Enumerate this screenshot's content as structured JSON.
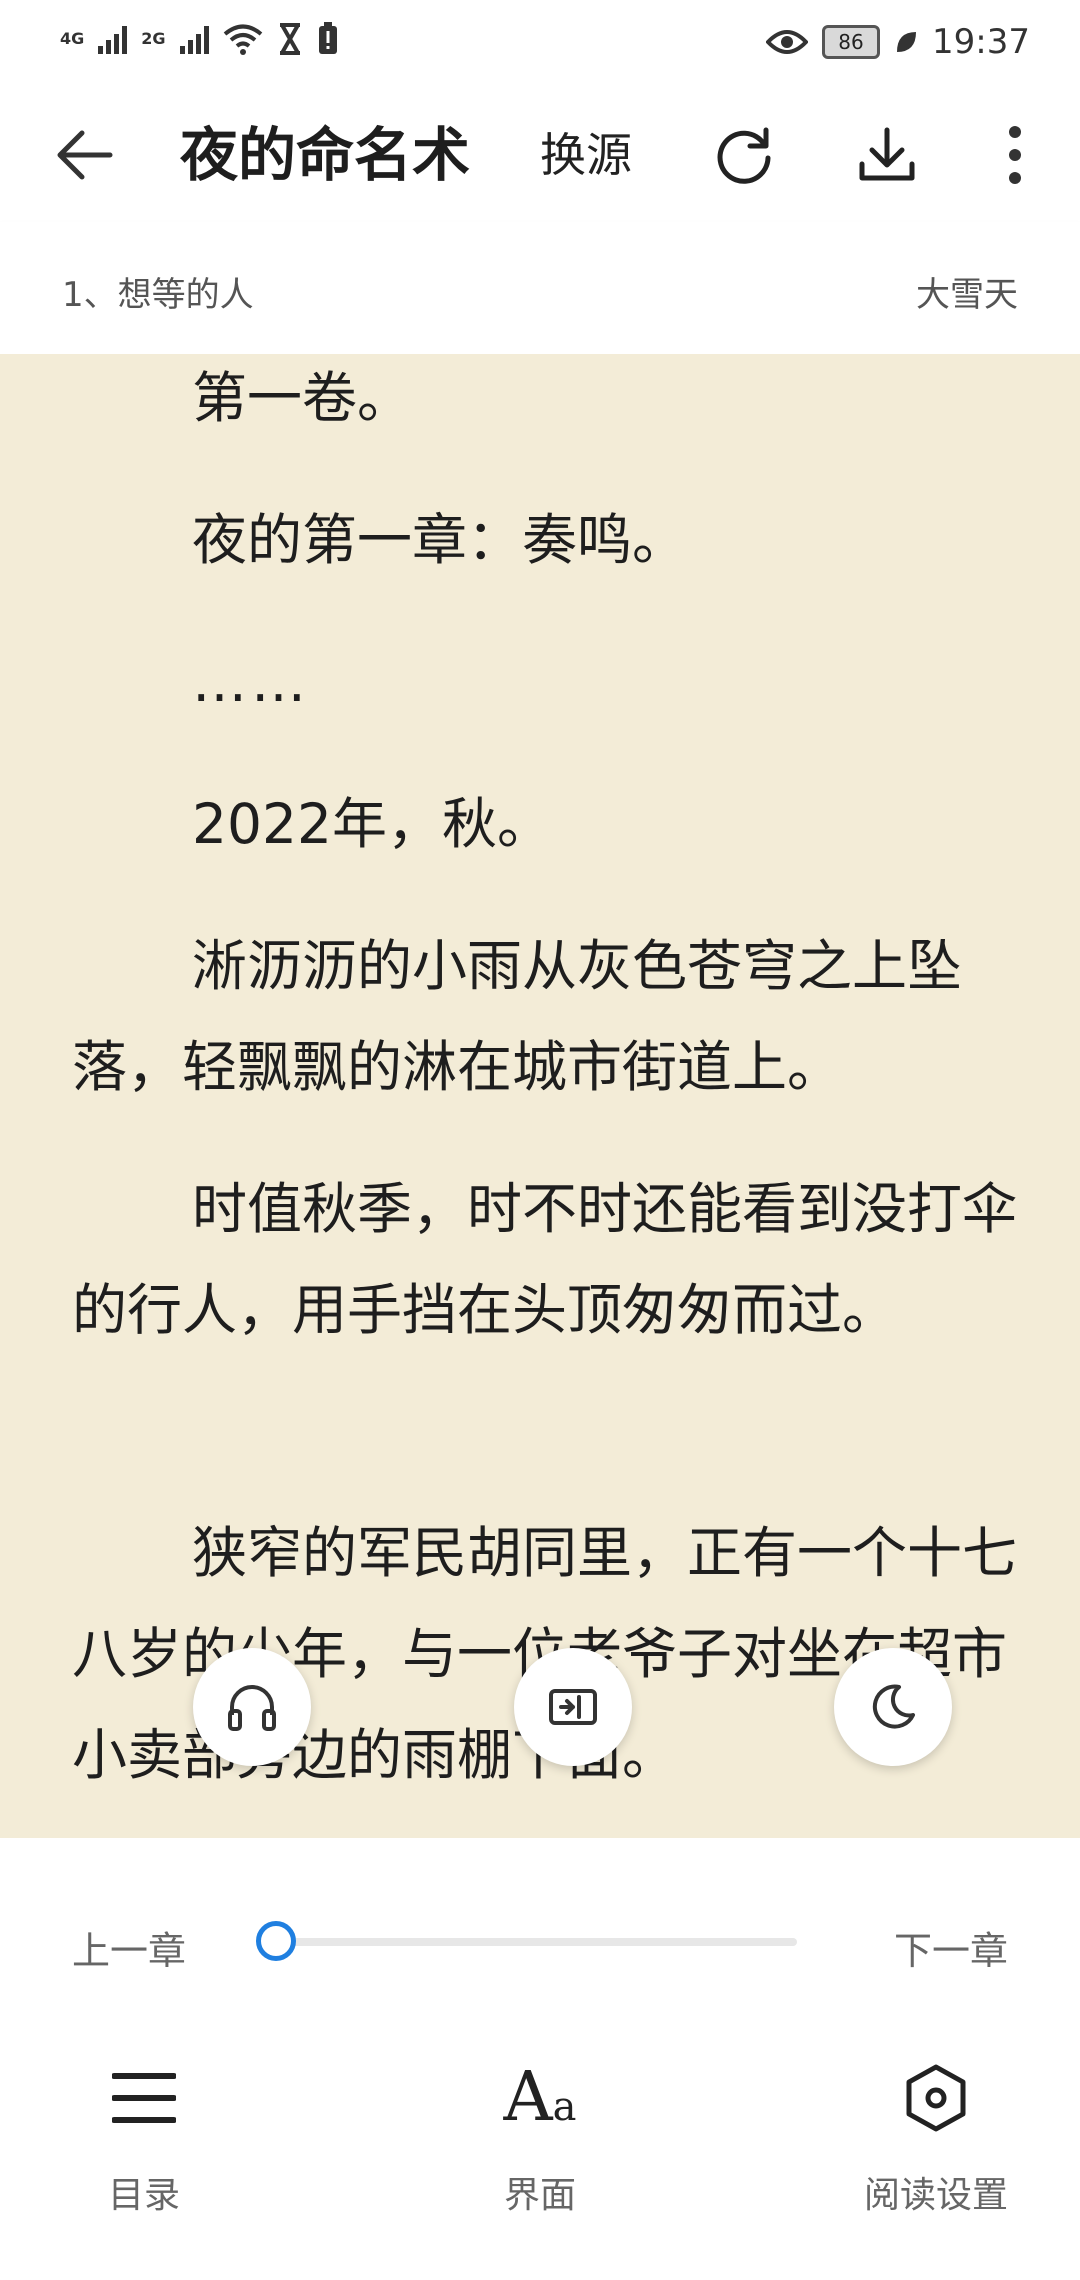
{
  "status_bar": {
    "network1": "4G",
    "network2": "2G",
    "battery": "86",
    "time": "19:37"
  },
  "toolbar": {
    "title": "夜的命名术",
    "change_source": "换源"
  },
  "chapter_header": {
    "chapter": "1、想等的人",
    "source": "大雪天"
  },
  "content": {
    "paragraphs": [
      "第一卷。",
      "夜的第一章：奏鸣。",
      "……",
      "2022年，秋。",
      "淅沥沥的小雨从灰色苍穹之上坠落，轻飘飘的淋在城市街道上。",
      "时值秋季，时不时还能看到没打伞的行人，用手挡在头顶匆匆而过。",
      "狭窄的军民胡同里，正有一个十七八岁的少年，与一位老爷子对坐在超市小卖部旁边的雨棚下面。"
    ]
  },
  "reader_controls": {
    "prev_chapter": "上一章",
    "next_chapter": "下一章",
    "progress": 0.0
  },
  "bottom_nav": {
    "catalog": "目录",
    "interface": "界面",
    "interface_glyph_big": "A",
    "interface_glyph_small": "a",
    "settings": "阅读设置"
  },
  "icons": {
    "back": "arrow-left-icon",
    "refresh": "refresh-icon",
    "download": "download-icon",
    "more": "more-vertical-icon",
    "listen": "headphones-icon",
    "auto_page": "auto-page-icon",
    "night": "moon-icon",
    "catalog": "menu-icon",
    "settings": "hexagon-settings-icon"
  },
  "colors": {
    "page_background": "#f3ecd7",
    "accent": "#1f7fe0"
  }
}
